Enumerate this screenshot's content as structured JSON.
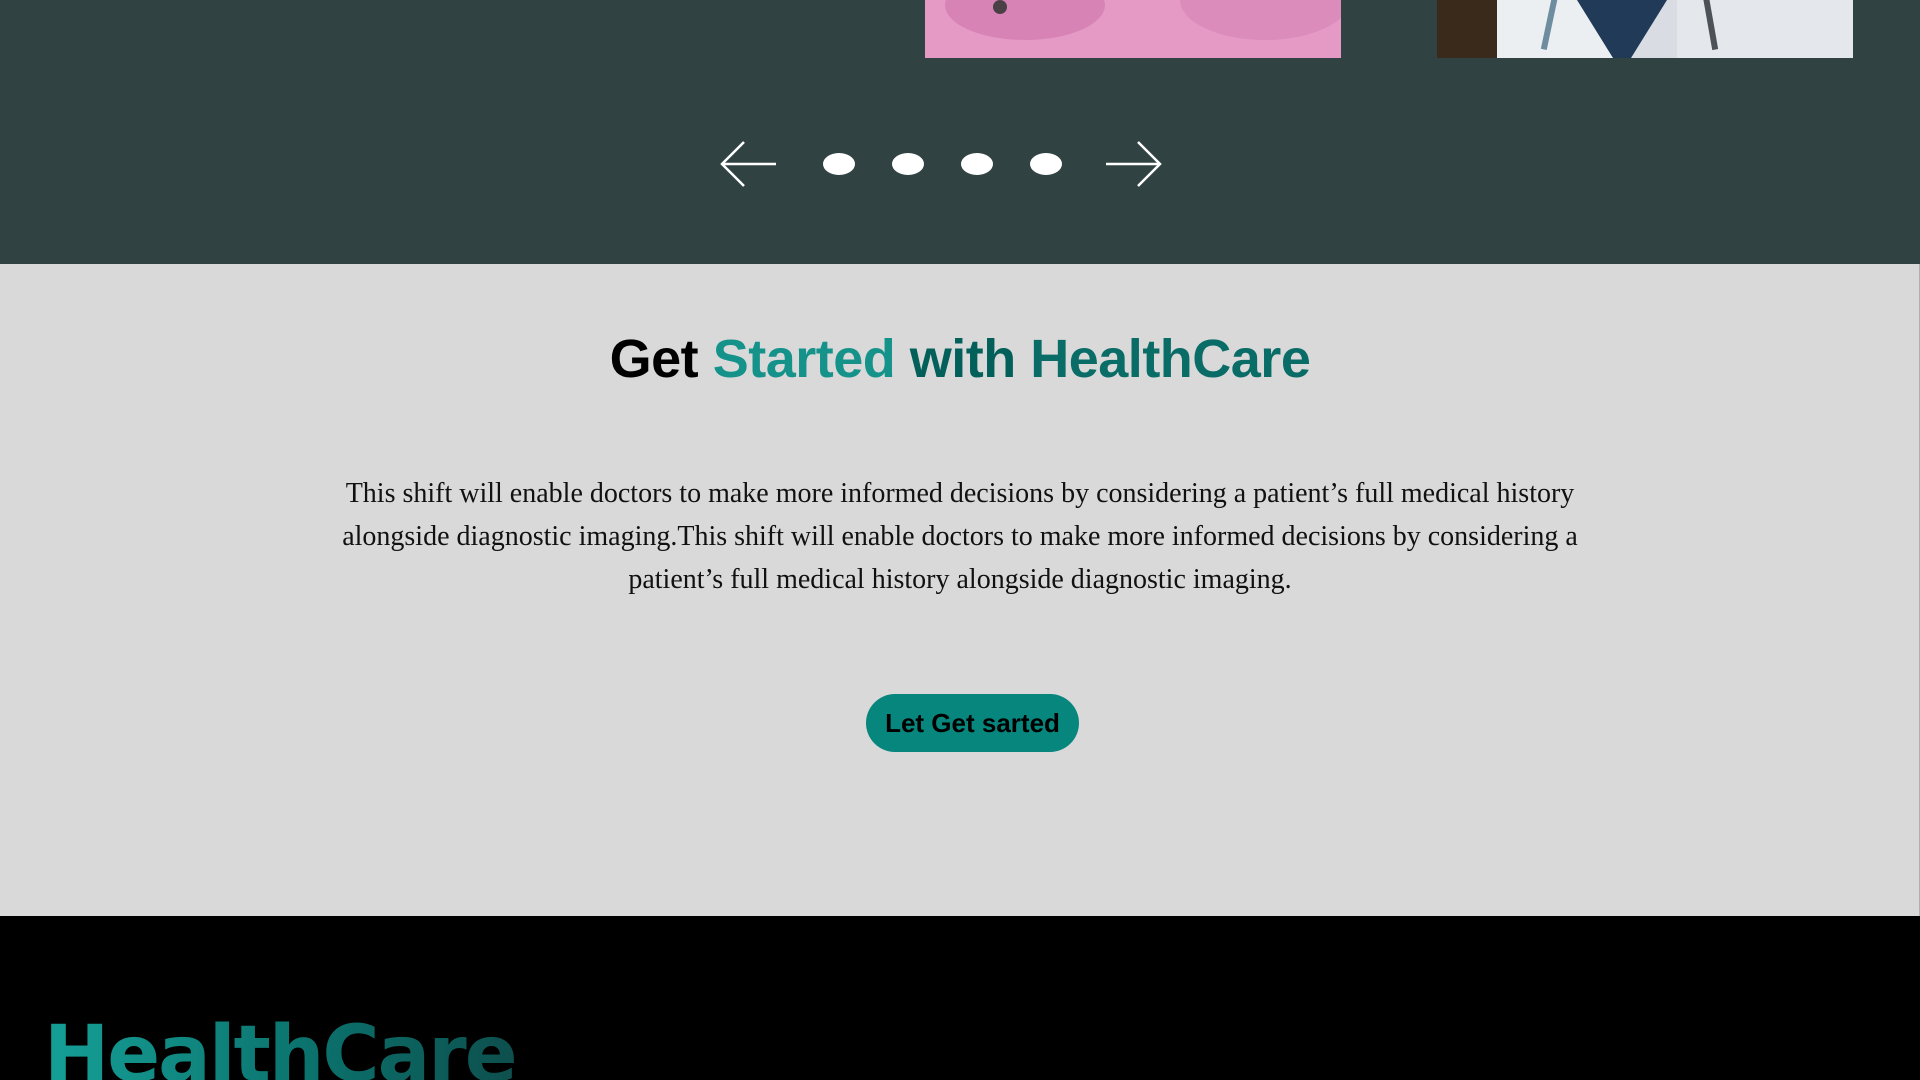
{
  "carousel": {
    "slide_count": 4,
    "prev_icon": "arrow-left-icon",
    "next_icon": "arrow-right-icon"
  },
  "cta": {
    "title_part1": "Get",
    "title_part2": "Started",
    "title_part3": "with",
    "title_part4": "HealthCare",
    "body": "This shift will enable doctors to make more informed decisions by considering a patient’s full medical history alongside diagnostic imaging.This shift will enable doctors to make more informed decisions by considering a patient’s full medical history alongside diagnostic imaging.",
    "button_label": "Let Get sarted"
  },
  "footer": {
    "logo_text": "HealthCare"
  },
  "colors": {
    "carousel_bg": "#314243",
    "section_bg": "#d9d9d9",
    "accent_teal": "#15938a",
    "dark_teal": "#035f5a",
    "button_bg": "#06867d",
    "footer_bg": "#000000"
  }
}
